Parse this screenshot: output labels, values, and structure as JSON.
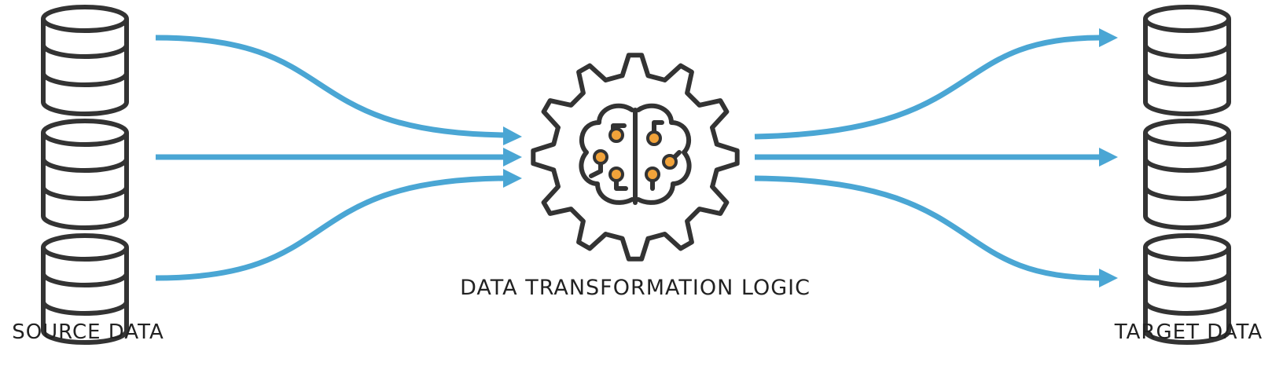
{
  "labels": {
    "source": "SOURCE DATA",
    "center": "DATA TRANSFORMATION LOGIC",
    "target": "TARGET DATA"
  },
  "icons": {
    "source_databases": [
      "database-icon",
      "database-icon",
      "database-icon"
    ],
    "center": "gear-brain-icon",
    "target_databases": [
      "database-icon",
      "database-icon",
      "database-icon"
    ]
  },
  "colors": {
    "flow": "#4aa6d4",
    "outline": "#333333",
    "node": "#f2a33a"
  }
}
